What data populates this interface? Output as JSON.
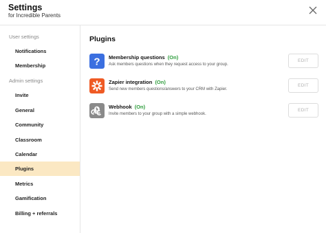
{
  "header": {
    "title": "Settings",
    "subtitle": "for Incredible Parents"
  },
  "sidebar": {
    "user_section_label": "User settings",
    "user_items": [
      {
        "label": "Notifications"
      },
      {
        "label": "Membership"
      }
    ],
    "admin_section_label": "Admin settings",
    "admin_items": [
      {
        "label": "Invite"
      },
      {
        "label": "General"
      },
      {
        "label": "Community"
      },
      {
        "label": "Classroom"
      },
      {
        "label": "Calendar"
      },
      {
        "label": "Plugins",
        "active": true
      },
      {
        "label": "Metrics"
      },
      {
        "label": "Gamification"
      },
      {
        "label": "Billing + referrals"
      }
    ]
  },
  "main": {
    "title": "Plugins",
    "plugins": [
      {
        "name": "Membership questions",
        "status": "(On)",
        "description": "Ask members questions when they request access to your group.",
        "edit_label": "EDIT",
        "icon": "question-mark-icon",
        "icon_color": "#3b6fe0"
      },
      {
        "name": "Zapier integration",
        "status": "(On)",
        "description": "Send new members questions/answers to your CRM with Zapier.",
        "edit_label": "EDIT",
        "icon": "zapier-asterisk-icon",
        "icon_color": "#ef5a24"
      },
      {
        "name": "Webhook",
        "status": "(On)",
        "description": "Invite members to your group with a simple webhook.",
        "edit_label": "EDIT",
        "icon": "webhook-icon",
        "icon_color": "#8a8a8a"
      }
    ]
  },
  "colors": {
    "active_nav_bg": "#fbe8c3",
    "status_on": "#2e9d3c"
  }
}
